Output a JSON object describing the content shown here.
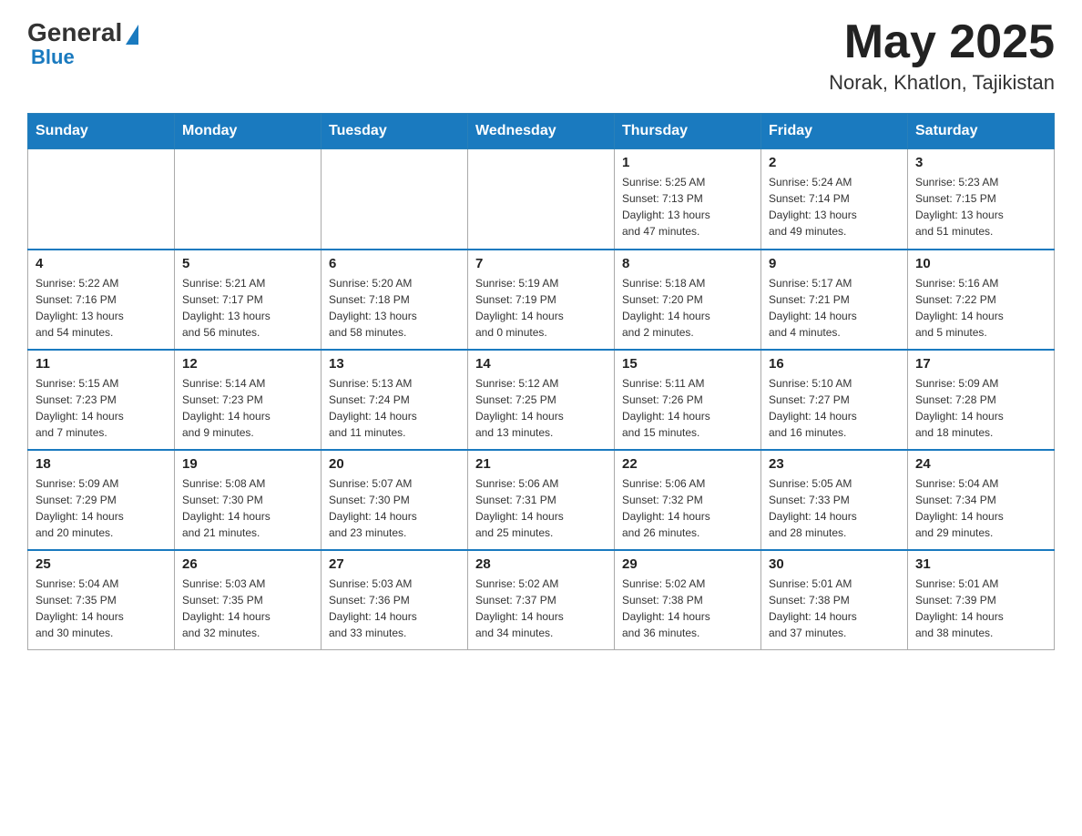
{
  "header": {
    "logo": {
      "general": "General",
      "blue": "Blue"
    },
    "title": "May 2025",
    "location": "Norak, Khatlon, Tajikistan"
  },
  "days_of_week": [
    "Sunday",
    "Monday",
    "Tuesday",
    "Wednesday",
    "Thursday",
    "Friday",
    "Saturday"
  ],
  "weeks": [
    [
      {
        "day": "",
        "info": ""
      },
      {
        "day": "",
        "info": ""
      },
      {
        "day": "",
        "info": ""
      },
      {
        "day": "",
        "info": ""
      },
      {
        "day": "1",
        "info": "Sunrise: 5:25 AM\nSunset: 7:13 PM\nDaylight: 13 hours\nand 47 minutes."
      },
      {
        "day": "2",
        "info": "Sunrise: 5:24 AM\nSunset: 7:14 PM\nDaylight: 13 hours\nand 49 minutes."
      },
      {
        "day": "3",
        "info": "Sunrise: 5:23 AM\nSunset: 7:15 PM\nDaylight: 13 hours\nand 51 minutes."
      }
    ],
    [
      {
        "day": "4",
        "info": "Sunrise: 5:22 AM\nSunset: 7:16 PM\nDaylight: 13 hours\nand 54 minutes."
      },
      {
        "day": "5",
        "info": "Sunrise: 5:21 AM\nSunset: 7:17 PM\nDaylight: 13 hours\nand 56 minutes."
      },
      {
        "day": "6",
        "info": "Sunrise: 5:20 AM\nSunset: 7:18 PM\nDaylight: 13 hours\nand 58 minutes."
      },
      {
        "day": "7",
        "info": "Sunrise: 5:19 AM\nSunset: 7:19 PM\nDaylight: 14 hours\nand 0 minutes."
      },
      {
        "day": "8",
        "info": "Sunrise: 5:18 AM\nSunset: 7:20 PM\nDaylight: 14 hours\nand 2 minutes."
      },
      {
        "day": "9",
        "info": "Sunrise: 5:17 AM\nSunset: 7:21 PM\nDaylight: 14 hours\nand 4 minutes."
      },
      {
        "day": "10",
        "info": "Sunrise: 5:16 AM\nSunset: 7:22 PM\nDaylight: 14 hours\nand 5 minutes."
      }
    ],
    [
      {
        "day": "11",
        "info": "Sunrise: 5:15 AM\nSunset: 7:23 PM\nDaylight: 14 hours\nand 7 minutes."
      },
      {
        "day": "12",
        "info": "Sunrise: 5:14 AM\nSunset: 7:23 PM\nDaylight: 14 hours\nand 9 minutes."
      },
      {
        "day": "13",
        "info": "Sunrise: 5:13 AM\nSunset: 7:24 PM\nDaylight: 14 hours\nand 11 minutes."
      },
      {
        "day": "14",
        "info": "Sunrise: 5:12 AM\nSunset: 7:25 PM\nDaylight: 14 hours\nand 13 minutes."
      },
      {
        "day": "15",
        "info": "Sunrise: 5:11 AM\nSunset: 7:26 PM\nDaylight: 14 hours\nand 15 minutes."
      },
      {
        "day": "16",
        "info": "Sunrise: 5:10 AM\nSunset: 7:27 PM\nDaylight: 14 hours\nand 16 minutes."
      },
      {
        "day": "17",
        "info": "Sunrise: 5:09 AM\nSunset: 7:28 PM\nDaylight: 14 hours\nand 18 minutes."
      }
    ],
    [
      {
        "day": "18",
        "info": "Sunrise: 5:09 AM\nSunset: 7:29 PM\nDaylight: 14 hours\nand 20 minutes."
      },
      {
        "day": "19",
        "info": "Sunrise: 5:08 AM\nSunset: 7:30 PM\nDaylight: 14 hours\nand 21 minutes."
      },
      {
        "day": "20",
        "info": "Sunrise: 5:07 AM\nSunset: 7:30 PM\nDaylight: 14 hours\nand 23 minutes."
      },
      {
        "day": "21",
        "info": "Sunrise: 5:06 AM\nSunset: 7:31 PM\nDaylight: 14 hours\nand 25 minutes."
      },
      {
        "day": "22",
        "info": "Sunrise: 5:06 AM\nSunset: 7:32 PM\nDaylight: 14 hours\nand 26 minutes."
      },
      {
        "day": "23",
        "info": "Sunrise: 5:05 AM\nSunset: 7:33 PM\nDaylight: 14 hours\nand 28 minutes."
      },
      {
        "day": "24",
        "info": "Sunrise: 5:04 AM\nSunset: 7:34 PM\nDaylight: 14 hours\nand 29 minutes."
      }
    ],
    [
      {
        "day": "25",
        "info": "Sunrise: 5:04 AM\nSunset: 7:35 PM\nDaylight: 14 hours\nand 30 minutes."
      },
      {
        "day": "26",
        "info": "Sunrise: 5:03 AM\nSunset: 7:35 PM\nDaylight: 14 hours\nand 32 minutes."
      },
      {
        "day": "27",
        "info": "Sunrise: 5:03 AM\nSunset: 7:36 PM\nDaylight: 14 hours\nand 33 minutes."
      },
      {
        "day": "28",
        "info": "Sunrise: 5:02 AM\nSunset: 7:37 PM\nDaylight: 14 hours\nand 34 minutes."
      },
      {
        "day": "29",
        "info": "Sunrise: 5:02 AM\nSunset: 7:38 PM\nDaylight: 14 hours\nand 36 minutes."
      },
      {
        "day": "30",
        "info": "Sunrise: 5:01 AM\nSunset: 7:38 PM\nDaylight: 14 hours\nand 37 minutes."
      },
      {
        "day": "31",
        "info": "Sunrise: 5:01 AM\nSunset: 7:39 PM\nDaylight: 14 hours\nand 38 minutes."
      }
    ]
  ]
}
